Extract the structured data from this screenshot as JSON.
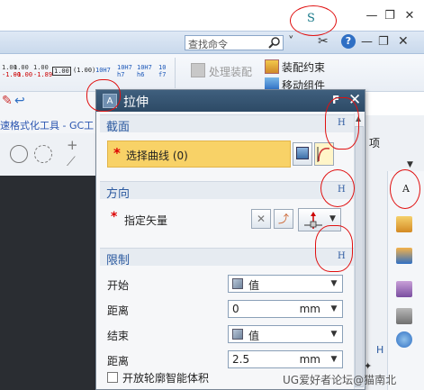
{
  "search": {
    "placeholder": "查找命令"
  },
  "ribbon": {
    "tolerances": [
      {
        "top": "1.00",
        "bottom": "-1.00"
      },
      {
        "top": "1.00",
        "bottom": "-1.00"
      },
      {
        "top": "1.00",
        "bottom": "-1.89"
      }
    ],
    "box_value": "1.00",
    "paren_value": "(1.00)",
    "fits": [
      "10H7",
      "10H7",
      "10H7",
      "10"
    ],
    "fits_bottom": [
      "",
      "h7",
      "h6",
      "f7"
    ],
    "process_assembly": "处理装配",
    "assembly_constraint": "装配约束",
    "move_component": "移动组件",
    "item_label": "项"
  },
  "toolbar_strip": {
    "title": "速格式化工具 - GC工"
  },
  "dialog": {
    "icon_letter": "A",
    "title": "拉伸",
    "sections": {
      "section": {
        "label": "截面",
        "collapse": "H"
      },
      "direction": {
        "label": "方向",
        "collapse": "H"
      },
      "limits": {
        "label": "限制",
        "collapse": "H"
      }
    },
    "select_curve": "选择曲线 (0)",
    "specify_vector": "指定矢量",
    "rows": {
      "start": {
        "label": "开始",
        "value": "值"
      },
      "start_distance": {
        "label": "距离",
        "value": "0",
        "unit": "mm"
      },
      "end": {
        "label": "结束",
        "value": "值"
      },
      "end_distance": {
        "label": "距离",
        "value": "2.5",
        "unit": "mm"
      }
    },
    "open_profile": "开放轮廓智能体积"
  },
  "annotations": {
    "s_mark": "S",
    "a_mark_left": "A",
    "f_mark": "F",
    "h_mark": "H",
    "a_mark_right": "A"
  },
  "right_strip": {
    "bottom_mark": "H"
  },
  "watermark": "UG爱好者论坛@猫南北",
  "colors": {
    "accent_blue": "#2c5aa0",
    "dialog_title": "#2d4a66",
    "select_yellow": "#f8d267",
    "annotation_red": "#e01010"
  }
}
